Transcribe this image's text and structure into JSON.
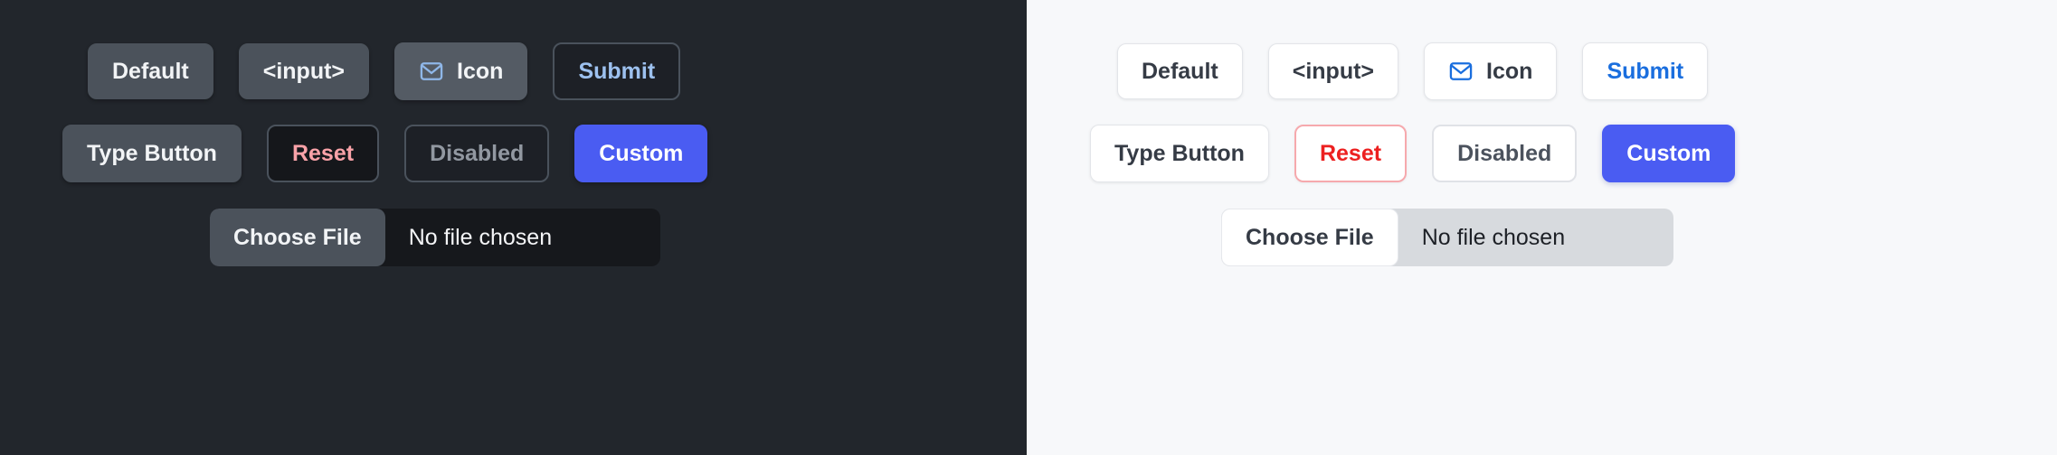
{
  "panels": [
    {
      "theme": "dark",
      "background": "#22262c",
      "rows": [
        {
          "buttons": [
            {
              "label": "Default",
              "variant": "default"
            },
            {
              "label": "<input>",
              "variant": "input"
            },
            {
              "label": "Icon",
              "variant": "icon",
              "icon": "envelope-icon"
            },
            {
              "label": "Submit",
              "variant": "submit"
            }
          ]
        },
        {
          "buttons": [
            {
              "label": "Type Button",
              "variant": "typebutton"
            },
            {
              "label": "Reset",
              "variant": "reset"
            },
            {
              "label": "Disabled",
              "variant": "disabled",
              "disabled": true
            },
            {
              "label": "Custom",
              "variant": "custom"
            }
          ]
        }
      ],
      "file_input": {
        "button_label": "Choose File",
        "status_text": "No file chosen"
      },
      "colors": {
        "panel_bg": "#22262c",
        "button_bg": "#4b525b",
        "icon_button_bg": "#545b64",
        "text": "#f2f4f6",
        "submit_text": "#9dc1ef",
        "reset_text": "#f9a2a8",
        "disabled_text": "#9298a1",
        "custom_bg": "#4a5cf2",
        "outline_border": "#4a525c",
        "envelope_stroke": "#8fb7e8",
        "file_track_bg": "#16181c"
      }
    },
    {
      "theme": "light",
      "background": "#f7f8fa",
      "rows": [
        {
          "buttons": [
            {
              "label": "Default",
              "variant": "default"
            },
            {
              "label": "<input>",
              "variant": "input"
            },
            {
              "label": "Icon",
              "variant": "icon",
              "icon": "envelope-icon"
            },
            {
              "label": "Submit",
              "variant": "submit"
            }
          ]
        },
        {
          "buttons": [
            {
              "label": "Type Button",
              "variant": "typebutton"
            },
            {
              "label": "Reset",
              "variant": "reset"
            },
            {
              "label": "Disabled",
              "variant": "disabled",
              "disabled": true
            },
            {
              "label": "Custom",
              "variant": "custom"
            }
          ]
        }
      ],
      "file_input": {
        "button_label": "Choose File",
        "status_text": "No file chosen"
      },
      "colors": {
        "panel_bg": "#f7f8fa",
        "button_bg": "#ffffff",
        "border": "#e3e5e9",
        "text": "#353b45",
        "submit_text": "#1a6ede",
        "reset_text": "#ec2020",
        "reset_border": "#f6a9ad",
        "disabled_text": "#4b525d",
        "disabled_border": "#e0e2e7",
        "custom_bg": "#4a5cf2",
        "envelope_stroke": "#1a6ede",
        "file_track_bg": "#d7dade"
      }
    }
  ]
}
